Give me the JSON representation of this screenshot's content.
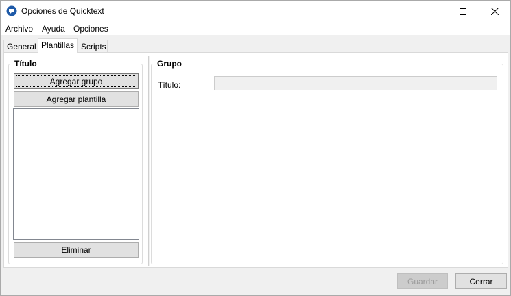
{
  "window": {
    "title": "Opciones de Quicktext",
    "icon": "quicktext-app-icon"
  },
  "menu": {
    "items": [
      "Archivo",
      "Ayuda",
      "Opciones"
    ]
  },
  "tabs": [
    {
      "label": "General",
      "active": false
    },
    {
      "label": "Plantillas",
      "active": true
    },
    {
      "label": "Scripts",
      "active": false
    }
  ],
  "left_group": {
    "title": "Título",
    "add_group_label": "Agregar grupo",
    "add_template_label": "Agregar plantilla",
    "delete_label": "Eliminar"
  },
  "right_group": {
    "title": "Grupo",
    "title_field_label": "Título:",
    "title_field_value": ""
  },
  "footer": {
    "save_label": "Guardar",
    "save_enabled": false,
    "close_label": "Cerrar"
  }
}
